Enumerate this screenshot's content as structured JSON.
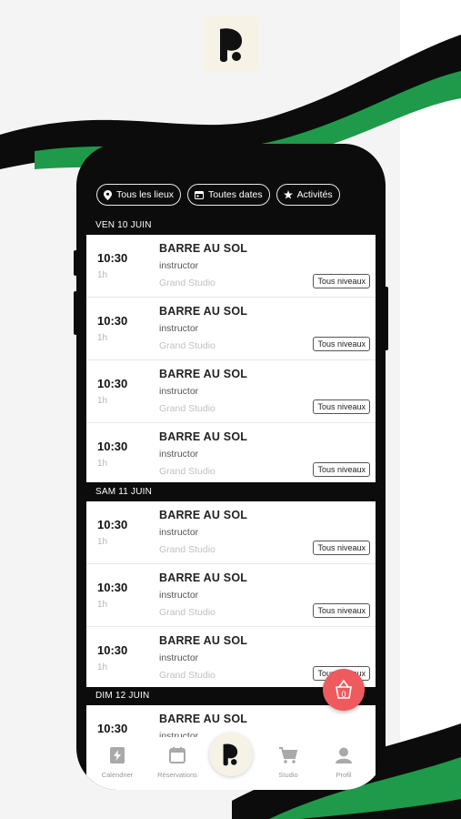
{
  "filters": {
    "location": "Tous les lieux",
    "dates": "Toutes dates",
    "activities": "Activités"
  },
  "days": [
    {
      "label": "VEN 10 JUIN",
      "sessions": [
        {
          "time": "10:30",
          "duration": "1h",
          "title": "BARRE AU SOL",
          "instructor": "instructor",
          "studio": "Grand Studio",
          "level": "Tous niveaux"
        },
        {
          "time": "10:30",
          "duration": "1h",
          "title": "BARRE AU SOL",
          "instructor": "instructor",
          "studio": "Grand Studio",
          "level": "Tous niveaux"
        },
        {
          "time": "10:30",
          "duration": "1h",
          "title": "BARRE AU SOL",
          "instructor": "instructor",
          "studio": "Grand Studio",
          "level": "Tous niveaux"
        },
        {
          "time": "10:30",
          "duration": "1h",
          "title": "BARRE AU SOL",
          "instructor": "instructor",
          "studio": "Grand Studio",
          "level": "Tous niveaux"
        }
      ]
    },
    {
      "label": "SAM 11 JUIN",
      "sessions": [
        {
          "time": "10:30",
          "duration": "1h",
          "title": "BARRE AU SOL",
          "instructor": "instructor",
          "studio": "Grand Studio",
          "level": "Tous niveaux"
        },
        {
          "time": "10:30",
          "duration": "1h",
          "title": "BARRE AU SOL",
          "instructor": "instructor",
          "studio": "Grand Studio",
          "level": "Tous niveaux"
        },
        {
          "time": "10:30",
          "duration": "1h",
          "title": "BARRE AU SOL",
          "instructor": "instructor",
          "studio": "Grand Studio",
          "level": "Tous niveaux"
        }
      ]
    },
    {
      "label": "DIM 12 JUIN",
      "sessions": [
        {
          "time": "10:30",
          "title": "BARRE AU SOL",
          "instructor": "instructor"
        }
      ]
    }
  ],
  "cart": {
    "count": "0"
  },
  "tabs": [
    {
      "label": "Calendrier",
      "icon": "lightning-calendar-icon"
    },
    {
      "label": "Réservations",
      "icon": "calendar-icon"
    },
    {
      "label": "",
      "icon": "brand-logo-icon"
    },
    {
      "label": "Studio",
      "icon": "cart-icon"
    },
    {
      "label": "Profil",
      "icon": "user-icon"
    }
  ],
  "colors": {
    "brand_green": "#1f9a4a",
    "brand_black": "#0c0c0c",
    "cart_red": "#ee5b5e",
    "logo_bg": "#f6f3e6"
  }
}
